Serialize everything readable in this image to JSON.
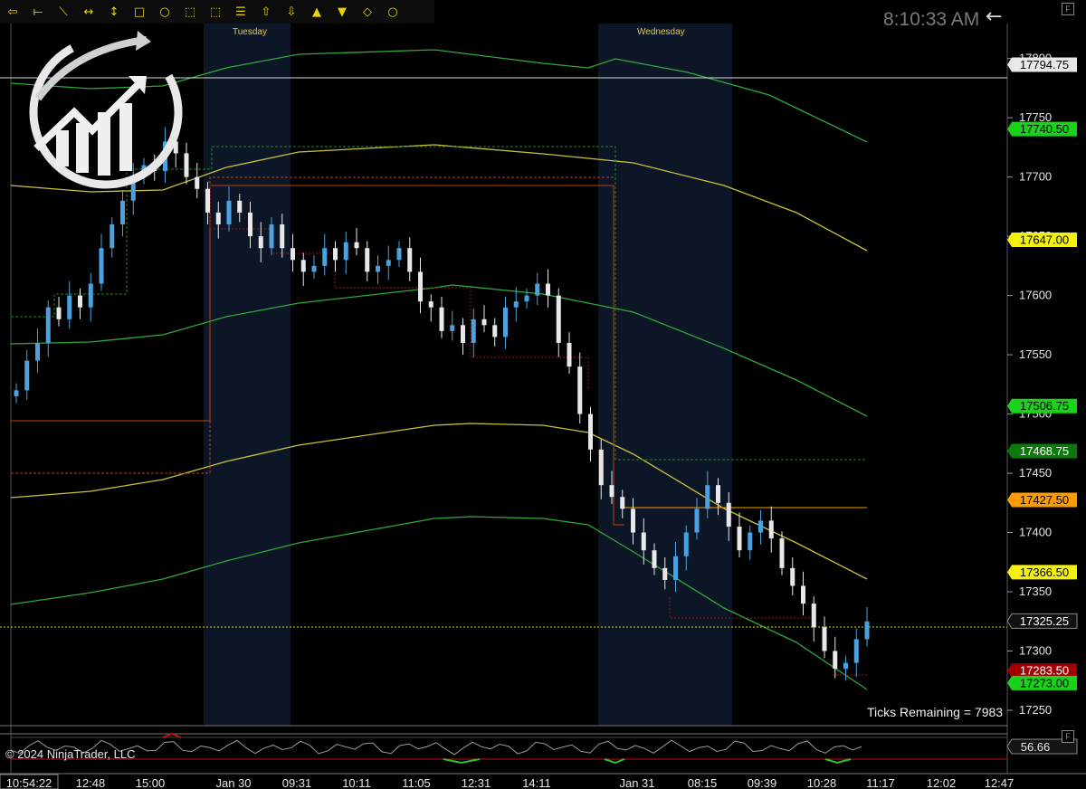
{
  "toolbar": {
    "tools": [
      {
        "name": "back-tool",
        "glyph": "⇦"
      },
      {
        "name": "horizontal-line-tool",
        "glyph": "⟝"
      },
      {
        "name": "line-tool",
        "glyph": "⟍"
      },
      {
        "name": "extended-line-tool",
        "glyph": "↔"
      },
      {
        "name": "vertical-line-tool",
        "glyph": "↕"
      },
      {
        "name": "rectangle-tool",
        "glyph": "□"
      },
      {
        "name": "ellipse-tool",
        "glyph": "○"
      },
      {
        "name": "region-tool",
        "glyph": "⬚"
      },
      {
        "name": "dashed-region-tool",
        "glyph": "⬚"
      },
      {
        "name": "fibonacci-tool",
        "glyph": "☰"
      },
      {
        "name": "arrow-up-tool",
        "glyph": "⇧"
      },
      {
        "name": "arrow-down-tool",
        "glyph": "⇩"
      },
      {
        "name": "triangle-up-tool",
        "glyph": "▲"
      },
      {
        "name": "triangle-down-tool",
        "glyph": "▼"
      },
      {
        "name": "diamond-tool",
        "glyph": "◇"
      },
      {
        "name": "circle-tool",
        "glyph": "○"
      }
    ]
  },
  "clock": "8:10:33 AM",
  "back_arrow": "←",
  "f_label": "F",
  "session_labels": {
    "tuesday": "Tuesday",
    "wednesday": "Wednesday"
  },
  "ticks_remaining": "Ticks Remaining = 7983",
  "copyright": "© 2024 NinjaTrader, LLC",
  "colors": {
    "background": "#000000",
    "up_candle": "#4aa3e0",
    "down_candle": "#e8e8e8",
    "band_green": "#2fa83a",
    "band_yellow": "#c8c23a",
    "session_shade": "#0d1626",
    "tag_green": "#19d219",
    "tag_yellow": "#f2f20e",
    "tag_orange": "#ff9a00",
    "tag_red": "#a00000",
    "tag_dark_green": "#0a7a0a"
  },
  "chart_data": {
    "type": "candlestick",
    "instrument_unit": "price",
    "ylim": [
      17237,
      17828
    ],
    "y_ticks": [
      17250,
      17300,
      17350,
      17400,
      17450,
      17500,
      17550,
      17600,
      17650,
      17700,
      17750,
      17800
    ],
    "x_labels": [
      "10:54:22",
      "12:48",
      "15:00",
      "Jan 30",
      "09:31",
      "10:11",
      "11:05",
      "12:31",
      "14:11",
      "Jan 31",
      "08:15",
      "09:39",
      "10:28",
      "11:17",
      "12:02",
      "12:47"
    ],
    "price_tags": [
      {
        "value": 17794.75,
        "label": "17794.75",
        "style": "white"
      },
      {
        "value": 17740.5,
        "label": "17740.50",
        "style": "green"
      },
      {
        "value": 17647.0,
        "label": "17647.00",
        "style": "yellow"
      },
      {
        "value": 17506.75,
        "label": "17506.75",
        "style": "green"
      },
      {
        "value": 17468.75,
        "label": "17468.75",
        "style": "dark-green"
      },
      {
        "value": 17427.5,
        "label": "17427.50",
        "style": "orange"
      },
      {
        "value": 17366.5,
        "label": "17366.50",
        "style": "yellow"
      },
      {
        "value": 17325.25,
        "label": "17325.25",
        "style": "dark"
      },
      {
        "value": 17283.5,
        "label": "17283.50",
        "style": "red"
      },
      {
        "value": 17273.0,
        "label": "17273.00",
        "style": "green"
      }
    ],
    "close_path": [
      17520,
      17545,
      17560,
      17590,
      17580,
      17600,
      17590,
      17610,
      17640,
      17660,
      17680,
      17700,
      17710,
      17705,
      17730,
      17720,
      17700,
      17690,
      17670,
      17660,
      17680,
      17670,
      17650,
      17640,
      17660,
      17640,
      17630,
      17620,
      17625,
      17640,
      17630,
      17645,
      17640,
      17620,
      17625,
      17630,
      17640,
      17620,
      17595,
      17590,
      17570,
      17575,
      17560,
      17580,
      17575,
      17565,
      17590,
      17595,
      17600,
      17610,
      17600,
      17560,
      17540,
      17500,
      17470,
      17440,
      17430,
      17420,
      17400,
      17385,
      17370,
      17360,
      17380,
      17400,
      17420,
      17440,
      17425,
      17405,
      17385,
      17400,
      17410,
      17395,
      17370,
      17355,
      17340,
      17320,
      17300,
      17285,
      17290,
      17310,
      17325
    ],
    "oscillator_value": "56.66"
  }
}
